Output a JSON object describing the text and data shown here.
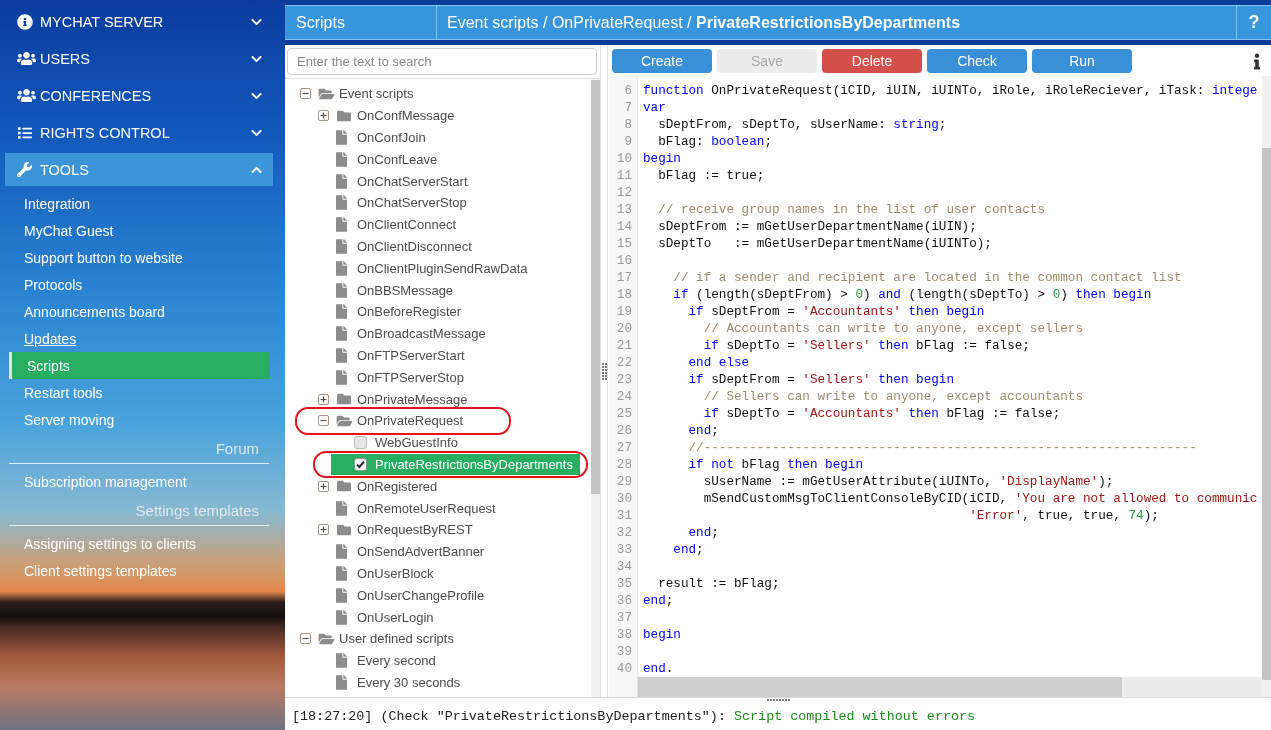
{
  "sidebar": {
    "sections": [
      {
        "label": "MYCHAT SERVER",
        "expanded": false
      },
      {
        "label": "USERS",
        "expanded": false
      },
      {
        "label": "CONFERENCES",
        "expanded": false
      },
      {
        "label": "RIGHTS CONTROL",
        "expanded": false
      },
      {
        "label": "TOOLS",
        "expanded": true,
        "items": [
          {
            "kind": "link",
            "label": "Integration",
            "selected": false,
            "hovered": false
          },
          {
            "kind": "link",
            "label": "MyChat Guest",
            "selected": false,
            "hovered": false
          },
          {
            "kind": "link",
            "label": "Support button to website",
            "selected": false,
            "hovered": false
          },
          {
            "kind": "link",
            "label": "Protocols",
            "selected": false,
            "hovered": false
          },
          {
            "kind": "link",
            "label": "Announcements board",
            "selected": false,
            "hovered": false
          },
          {
            "kind": "link",
            "label": "Updates",
            "selected": false,
            "hovered": true
          },
          {
            "kind": "link",
            "label": "Scripts",
            "selected": true,
            "hovered": false
          },
          {
            "kind": "link",
            "label": "Restart tools",
            "selected": false,
            "hovered": false
          },
          {
            "kind": "link",
            "label": "Server moving",
            "selected": false,
            "hovered": false
          },
          {
            "kind": "heading",
            "label": "Forum"
          },
          {
            "kind": "link",
            "label": "Subscription management",
            "selected": false,
            "hovered": false
          },
          {
            "kind": "heading",
            "label": "Settings templates"
          },
          {
            "kind": "link",
            "label": "Assigning settings to clients",
            "selected": false,
            "hovered": false
          },
          {
            "kind": "link",
            "label": "Client settings templates",
            "selected": false,
            "hovered": false
          }
        ]
      }
    ]
  },
  "header": {
    "title": "Scripts",
    "breadcrumb": "Event scripts / OnPrivateRequest / **PrivateRestrictionsByDepartments**",
    "help": "?"
  },
  "explorer": {
    "search": {
      "placeholder": "Enter the text to search"
    },
    "tree": [
      {
        "label": "Event scripts",
        "kind": "folder",
        "expanded": true,
        "selected": false,
        "highlighted": false,
        "children": [
          {
            "label": "OnConfMessage",
            "kind": "folder",
            "expanded": false,
            "selected": false,
            "highlighted": false
          },
          {
            "label": "OnConfJoin",
            "kind": "file",
            "selected": false,
            "highlighted": false
          },
          {
            "label": "OnConfLeave",
            "kind": "file",
            "selected": false,
            "highlighted": false
          },
          {
            "label": "OnChatServerStart",
            "kind": "file",
            "selected": false,
            "highlighted": false
          },
          {
            "label": "OnChatServerStop",
            "kind": "file",
            "selected": false,
            "highlighted": false
          },
          {
            "label": "OnClientConnect",
            "kind": "file",
            "selected": false,
            "highlighted": false
          },
          {
            "label": "OnClientDisconnect",
            "kind": "file",
            "selected": false,
            "highlighted": false
          },
          {
            "label": "OnClientPluginSendRawData",
            "kind": "file",
            "selected": false,
            "highlighted": false
          },
          {
            "label": "OnBBSMessage",
            "kind": "file",
            "selected": false,
            "highlighted": false
          },
          {
            "label": "OnBeforeRegister",
            "kind": "file",
            "selected": false,
            "highlighted": false
          },
          {
            "label": "OnBroadcastMessage",
            "kind": "file",
            "selected": false,
            "highlighted": false
          },
          {
            "label": "OnFTPServerStart",
            "kind": "file",
            "selected": false,
            "highlighted": false
          },
          {
            "label": "OnFTPServerStop",
            "kind": "file",
            "selected": false,
            "highlighted": false
          },
          {
            "label": "OnPrivateMessage",
            "kind": "folder",
            "expanded": false,
            "selected": false,
            "highlighted": false
          },
          {
            "label": "OnPrivateRequest",
            "kind": "folder",
            "expanded": true,
            "selected": false,
            "highlighted": true,
            "children": [
              {
                "label": "WebGuestInfo",
                "kind": "script",
                "checked": false,
                "selected": false,
                "highlighted": false
              },
              {
                "label": "PrivateRestrictionsByDepartments",
                "kind": "script",
                "checked": true,
                "selected": true,
                "highlighted": true
              }
            ]
          },
          {
            "label": "OnRegistered",
            "kind": "folder",
            "expanded": false,
            "selected": false,
            "highlighted": false
          },
          {
            "label": "OnRemoteUserRequest",
            "kind": "file",
            "selected": false,
            "highlighted": false
          },
          {
            "label": "OnRequestByREST",
            "kind": "folder",
            "expanded": false,
            "selected": false,
            "highlighted": false
          },
          {
            "label": "OnSendAdvertBanner",
            "kind": "file",
            "selected": false,
            "highlighted": false
          },
          {
            "label": "OnUserBlock",
            "kind": "file",
            "selected": false,
            "highlighted": false
          },
          {
            "label": "OnUserChangeProfile",
            "kind": "file",
            "selected": false,
            "highlighted": false
          },
          {
            "label": "OnUserLogin",
            "kind": "file",
            "selected": false,
            "highlighted": false
          }
        ]
      },
      {
        "label": "User defined scripts",
        "kind": "folder",
        "expanded": true,
        "selected": false,
        "highlighted": false,
        "children": [
          {
            "label": "Every second",
            "kind": "file",
            "selected": false,
            "highlighted": false
          },
          {
            "label": "Every 30 seconds",
            "kind": "file",
            "selected": false,
            "highlighted": false
          }
        ]
      }
    ]
  },
  "toolbar": {
    "buttons": [
      {
        "label": "Create",
        "kind": "primary",
        "disabled": false
      },
      {
        "label": "Save",
        "kind": "primary",
        "disabled": true
      },
      {
        "label": "Delete",
        "kind": "danger",
        "disabled": false
      },
      {
        "label": "Check",
        "kind": "primary",
        "disabled": false
      },
      {
        "label": "Run",
        "kind": "primary",
        "disabled": false
      }
    ]
  },
  "editor": {
    "lines": [
      {
        "number": "6",
        "tokens": [
          {
            "kind": "keyword",
            "text": "function"
          },
          {
            "kind": "plain",
            "text": " OnPrivateRequest(iCID, iUIN, iUINTo, iRole, iRoleReciever, iTask: "
          },
          {
            "kind": "keyword",
            "text": "intege"
          }
        ]
      },
      {
        "number": "7",
        "tokens": [
          {
            "kind": "keyword",
            "text": "var"
          }
        ]
      },
      {
        "number": "8",
        "tokens": [
          {
            "kind": "plain",
            "text": "  sDeptFrom, sDeptTo, sUserName: "
          },
          {
            "kind": "keyword",
            "text": "string"
          },
          {
            "kind": "plain",
            "text": ";"
          }
        ]
      },
      {
        "number": "9",
        "tokens": [
          {
            "kind": "plain",
            "text": "  bFlag: "
          },
          {
            "kind": "keyword",
            "text": "boolean"
          },
          {
            "kind": "plain",
            "text": ";"
          }
        ]
      },
      {
        "number": "10",
        "tokens": [
          {
            "kind": "keyword",
            "text": "begin"
          }
        ]
      },
      {
        "number": "11",
        "tokens": [
          {
            "kind": "plain",
            "text": "  bFlag := true;"
          }
        ]
      },
      {
        "number": "12"
      },
      {
        "number": "13",
        "tokens": [
          {
            "kind": "comment",
            "text": "  // receive group names in the list of user contacts"
          }
        ]
      },
      {
        "number": "14",
        "tokens": [
          {
            "kind": "plain",
            "text": "  sDeptFrom := mGetUserDepartmentName(iUIN);"
          }
        ]
      },
      {
        "number": "15",
        "tokens": [
          {
            "kind": "plain",
            "text": "  sDeptTo   := mGetUserDepartmentName(iUINTo);"
          }
        ]
      },
      {
        "number": "16"
      },
      {
        "number": "17",
        "tokens": [
          {
            "kind": "comment",
            "text": "    // if a sender and recipient are located in the common contact list"
          }
        ]
      },
      {
        "number": "18",
        "tokens": [
          {
            "kind": "keyword",
            "text": "    if"
          },
          {
            "kind": "plain",
            "text": " (length(sDeptFrom) > "
          },
          {
            "kind": "number",
            "text": "0"
          },
          {
            "kind": "plain",
            "text": ") "
          },
          {
            "kind": "keyword",
            "text": "and"
          },
          {
            "kind": "plain",
            "text": " (length(sDeptTo) > "
          },
          {
            "kind": "number",
            "text": "0"
          },
          {
            "kind": "plain",
            "text": ") "
          },
          {
            "kind": "keyword",
            "text": "then begin"
          }
        ]
      },
      {
        "number": "19",
        "tokens": [
          {
            "kind": "keyword",
            "text": "      if"
          },
          {
            "kind": "plain",
            "text": " sDeptFrom = "
          },
          {
            "kind": "string",
            "text": "'Accountants'"
          },
          {
            "kind": "keyword",
            "text": " then begin"
          }
        ]
      },
      {
        "number": "20",
        "tokens": [
          {
            "kind": "comment",
            "text": "        // Accountants can write to anyone, except sellers"
          }
        ]
      },
      {
        "number": "21",
        "tokens": [
          {
            "kind": "keyword",
            "text": "        if"
          },
          {
            "kind": "plain",
            "text": " sDeptTo = "
          },
          {
            "kind": "string",
            "text": "'Sellers'"
          },
          {
            "kind": "keyword",
            "text": " then"
          },
          {
            "kind": "plain",
            "text": " bFlag := false;"
          }
        ]
      },
      {
        "number": "22",
        "tokens": [
          {
            "kind": "keyword",
            "text": "      end else"
          }
        ]
      },
      {
        "number": "23",
        "tokens": [
          {
            "kind": "keyword",
            "text": "      if"
          },
          {
            "kind": "plain",
            "text": " sDeptFrom = "
          },
          {
            "kind": "string",
            "text": "'Sellers'"
          },
          {
            "kind": "keyword",
            "text": " then begin"
          }
        ]
      },
      {
        "number": "24",
        "tokens": [
          {
            "kind": "comment",
            "text": "        // Sellers can write to anyone, except accountants"
          }
        ]
      },
      {
        "number": "25",
        "tokens": [
          {
            "kind": "keyword",
            "text": "        if"
          },
          {
            "kind": "plain",
            "text": " sDeptTo = "
          },
          {
            "kind": "string",
            "text": "'Accountants'"
          },
          {
            "kind": "keyword",
            "text": " then"
          },
          {
            "kind": "plain",
            "text": " bFlag := false;"
          }
        ]
      },
      {
        "number": "26",
        "tokens": [
          {
            "kind": "keyword",
            "text": "      end"
          },
          {
            "kind": "plain",
            "text": ";"
          }
        ]
      },
      {
        "number": "27",
        "tokens": [
          {
            "kind": "comment",
            "text": "      //-----------------------------------------------------------------"
          }
        ]
      },
      {
        "number": "28",
        "tokens": [
          {
            "kind": "keyword",
            "text": "      if not"
          },
          {
            "kind": "plain",
            "text": " bFlag "
          },
          {
            "kind": "keyword",
            "text": "then begin"
          }
        ]
      },
      {
        "number": "29",
        "tokens": [
          {
            "kind": "plain",
            "text": "        sUserName := mGetUserAttribute(iUINTo, "
          },
          {
            "kind": "string",
            "text": "'DisplayName'"
          },
          {
            "kind": "plain",
            "text": ");"
          }
        ]
      },
      {
        "number": "30",
        "tokens": [
          {
            "kind": "plain",
            "text": "        mSendCustomMsgToClientConsoleByCID(iCID, "
          },
          {
            "kind": "string",
            "text": "'You are not allowed to communic"
          }
        ]
      },
      {
        "number": "31",
        "tokens": [
          {
            "kind": "string",
            "text": "                                           'Error'"
          },
          {
            "kind": "plain",
            "text": ", true, true, "
          },
          {
            "kind": "number",
            "text": "74"
          },
          {
            "kind": "plain",
            "text": ");"
          }
        ]
      },
      {
        "number": "32",
        "tokens": [
          {
            "kind": "keyword",
            "text": "      end"
          },
          {
            "kind": "plain",
            "text": ";"
          }
        ]
      },
      {
        "number": "33",
        "tokens": [
          {
            "kind": "keyword",
            "text": "    end"
          },
          {
            "kind": "plain",
            "text": ";"
          }
        ]
      },
      {
        "number": "34"
      },
      {
        "number": "35",
        "tokens": [
          {
            "kind": "plain",
            "text": "  result := bFlag;"
          }
        ]
      },
      {
        "number": "36",
        "tokens": [
          {
            "kind": "keyword",
            "text": "end"
          },
          {
            "kind": "plain",
            "text": ";"
          }
        ]
      },
      {
        "number": "37"
      },
      {
        "number": "38",
        "tokens": [
          {
            "kind": "keyword",
            "text": "begin"
          }
        ]
      },
      {
        "number": "39"
      },
      {
        "number": "40",
        "tokens": [
          {
            "kind": "keyword",
            "text": "end"
          },
          {
            "kind": "plain",
            "text": "."
          }
        ]
      }
    ]
  },
  "console": {
    "entries": [
      {
        "prefix": "[18:27:20] (Check \"PrivateRestrictionsByDepartments\"):",
        "message": "Script compiled without errors",
        "kind": "success"
      }
    ]
  }
}
